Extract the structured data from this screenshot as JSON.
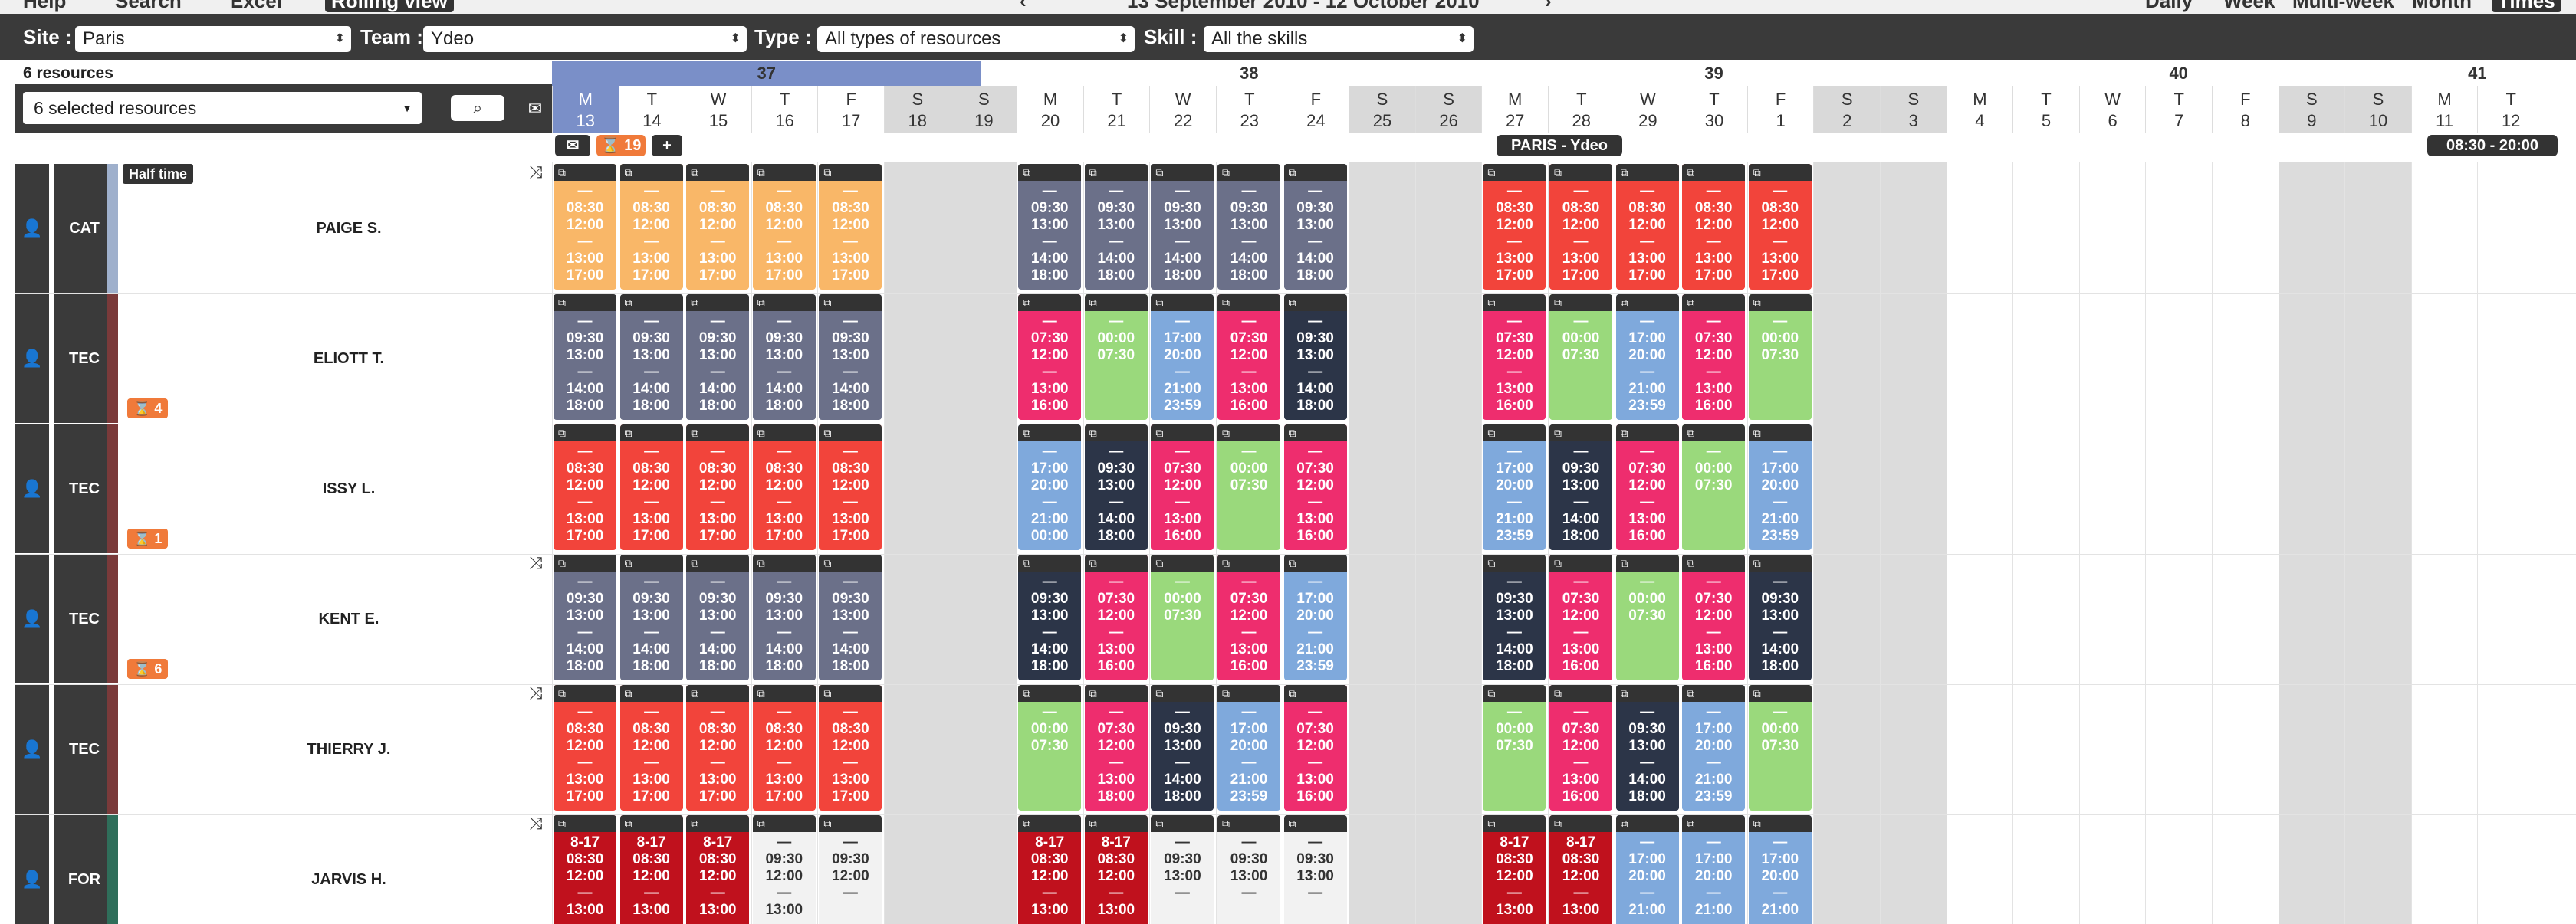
{
  "topbar": {
    "help": "Help",
    "search": "Search",
    "excel": "Excel",
    "rolling": "Rolling view",
    "date_range": "13 September 2010 - 12 October 2010",
    "views": [
      "Daily",
      "Week",
      "Multi-week",
      "Month",
      "Times"
    ]
  },
  "filters": {
    "site_label": "Site :",
    "site_value": "Paris",
    "team_label": "Team :",
    "team_value": "Ydeo",
    "type_label": "Type :",
    "type_value": "All types of resources",
    "skill_label": "Skill :",
    "skill_value": "All the skills"
  },
  "resources_count": "6 resources",
  "resource_select": "6 selected resources",
  "weeks": [
    "37",
    "38",
    "39",
    "40",
    "41"
  ],
  "days": [
    [
      "M",
      "13"
    ],
    [
      "T",
      "14"
    ],
    [
      "W",
      "15"
    ],
    [
      "T",
      "16"
    ],
    [
      "F",
      "17"
    ],
    [
      "S",
      "18"
    ],
    [
      "S",
      "19"
    ],
    [
      "M",
      "20"
    ],
    [
      "T",
      "21"
    ],
    [
      "W",
      "22"
    ],
    [
      "T",
      "23"
    ],
    [
      "F",
      "24"
    ],
    [
      "S",
      "25"
    ],
    [
      "S",
      "26"
    ],
    [
      "M",
      "27"
    ],
    [
      "T",
      "28"
    ],
    [
      "W",
      "29"
    ],
    [
      "T",
      "30"
    ],
    [
      "F",
      "1"
    ],
    [
      "S",
      "2"
    ],
    [
      "S",
      "3"
    ],
    [
      "M",
      "4"
    ],
    [
      "T",
      "5"
    ],
    [
      "W",
      "6"
    ],
    [
      "T",
      "7"
    ],
    [
      "F",
      "8"
    ],
    [
      "S",
      "9"
    ],
    [
      "S",
      "10"
    ],
    [
      "M",
      "11"
    ],
    [
      "T",
      "12"
    ]
  ],
  "toolbar": {
    "count": "19",
    "plus": "+",
    "team_label": "PARIS - Ydeo",
    "hours": "08:30 - 20:00"
  },
  "half_time": "Half time",
  "colors": {
    "orange": "#f9b768",
    "slate": "#6b7089",
    "red": "#f2443b",
    "pink": "#ee2d6e",
    "green": "#9ad97c",
    "blue": "#7fa9dc",
    "navy": "#2c3548",
    "darkred": "#c0111d",
    "white": "#f2f2f2"
  },
  "rows": [
    {
      "cat": "CAT",
      "name": "PAIGE S.",
      "stripe": "#9fb0cc",
      "badge": "",
      "shuffle": true,
      "cells": [
        [
          0,
          "orange",
          "—",
          "08:30",
          "12:00",
          "—",
          "13:00",
          "17:00"
        ],
        [
          1,
          "orange",
          "—",
          "08:30",
          "12:00",
          "—",
          "13:00",
          "17:00"
        ],
        [
          2,
          "orange",
          "—",
          "08:30",
          "12:00",
          "—",
          "13:00",
          "17:00"
        ],
        [
          3,
          "orange",
          "—",
          "08:30",
          "12:00",
          "—",
          "13:00",
          "17:00"
        ],
        [
          4,
          "orange",
          "—",
          "08:30",
          "12:00",
          "—",
          "13:00",
          "17:00"
        ],
        [
          7,
          "slate",
          "—",
          "09:30",
          "13:00",
          "—",
          "14:00",
          "18:00"
        ],
        [
          8,
          "slate",
          "—",
          "09:30",
          "13:00",
          "—",
          "14:00",
          "18:00"
        ],
        [
          9,
          "slate",
          "—",
          "09:30",
          "13:00",
          "—",
          "14:00",
          "18:00"
        ],
        [
          10,
          "slate",
          "—",
          "09:30",
          "13:00",
          "—",
          "14:00",
          "18:00"
        ],
        [
          11,
          "slate",
          "—",
          "09:30",
          "13:00",
          "—",
          "14:00",
          "18:00"
        ],
        [
          14,
          "red",
          "—",
          "08:30",
          "12:00",
          "—",
          "13:00",
          "17:00"
        ],
        [
          15,
          "red",
          "—",
          "08:30",
          "12:00",
          "—",
          "13:00",
          "17:00"
        ],
        [
          16,
          "red",
          "—",
          "08:30",
          "12:00",
          "—",
          "13:00",
          "17:00"
        ],
        [
          17,
          "red",
          "—",
          "08:30",
          "12:00",
          "—",
          "13:00",
          "17:00"
        ],
        [
          18,
          "red",
          "—",
          "08:30",
          "12:00",
          "—",
          "13:00",
          "17:00"
        ]
      ]
    },
    {
      "cat": "TEC",
      "name": "ELIOTT T.",
      "stripe": "#7a3a3a",
      "badge": "4",
      "shuffle": false,
      "cells": [
        [
          0,
          "slate",
          "—",
          "09:30",
          "13:00",
          "—",
          "14:00",
          "18:00"
        ],
        [
          1,
          "slate",
          "—",
          "09:30",
          "13:00",
          "—",
          "14:00",
          "18:00"
        ],
        [
          2,
          "slate",
          "—",
          "09:30",
          "13:00",
          "—",
          "14:00",
          "18:00"
        ],
        [
          3,
          "slate",
          "—",
          "09:30",
          "13:00",
          "—",
          "14:00",
          "18:00"
        ],
        [
          4,
          "slate",
          "—",
          "09:30",
          "13:00",
          "—",
          "14:00",
          "18:00"
        ],
        [
          7,
          "pink",
          "—",
          "07:30",
          "12:00",
          "—",
          "13:00",
          "16:00"
        ],
        [
          8,
          "green",
          "—",
          "00:00",
          "07:30",
          "",
          "",
          ""
        ],
        [
          9,
          "blue",
          "—",
          "17:00",
          "20:00",
          "—",
          "21:00",
          "23:59"
        ],
        [
          10,
          "pink",
          "—",
          "07:30",
          "12:00",
          "—",
          "13:00",
          "16:00"
        ],
        [
          11,
          "navy",
          "—",
          "09:30",
          "13:00",
          "—",
          "14:00",
          "18:00"
        ],
        [
          14,
          "pink",
          "—",
          "07:30",
          "12:00",
          "—",
          "13:00",
          "16:00"
        ],
        [
          15,
          "green",
          "—",
          "00:00",
          "07:30",
          "",
          "",
          ""
        ],
        [
          16,
          "blue",
          "—",
          "17:00",
          "20:00",
          "—",
          "21:00",
          "23:59"
        ],
        [
          17,
          "pink",
          "—",
          "07:30",
          "12:00",
          "—",
          "13:00",
          "16:00"
        ],
        [
          18,
          "green",
          "—",
          "00:00",
          "07:30",
          "",
          "",
          ""
        ]
      ]
    },
    {
      "cat": "TEC",
      "name": "ISSY L.",
      "stripe": "#7a3a3a",
      "badge": "1",
      "shuffle": false,
      "cells": [
        [
          0,
          "red",
          "—",
          "08:30",
          "12:00",
          "—",
          "13:00",
          "17:00"
        ],
        [
          1,
          "red",
          "—",
          "08:30",
          "12:00",
          "—",
          "13:00",
          "17:00"
        ],
        [
          2,
          "red",
          "—",
          "08:30",
          "12:00",
          "—",
          "13:00",
          "17:00"
        ],
        [
          3,
          "red",
          "—",
          "08:30",
          "12:00",
          "—",
          "13:00",
          "17:00"
        ],
        [
          4,
          "red",
          "—",
          "08:30",
          "12:00",
          "—",
          "13:00",
          "17:00"
        ],
        [
          7,
          "blue",
          "—",
          "17:00",
          "20:00",
          "—",
          "21:00",
          "00:00"
        ],
        [
          8,
          "navy",
          "—",
          "09:30",
          "13:00",
          "—",
          "14:00",
          "18:00"
        ],
        [
          9,
          "pink",
          "—",
          "07:30",
          "12:00",
          "—",
          "13:00",
          "16:00"
        ],
        [
          10,
          "green",
          "—",
          "00:00",
          "07:30",
          "",
          "",
          ""
        ],
        [
          11,
          "pink",
          "—",
          "07:30",
          "12:00",
          "—",
          "13:00",
          "16:00"
        ],
        [
          14,
          "blue",
          "—",
          "17:00",
          "20:00",
          "—",
          "21:00",
          "23:59"
        ],
        [
          15,
          "navy",
          "—",
          "09:30",
          "13:00",
          "—",
          "14:00",
          "18:00"
        ],
        [
          16,
          "pink",
          "—",
          "07:30",
          "12:00",
          "—",
          "13:00",
          "16:00"
        ],
        [
          17,
          "green",
          "—",
          "00:00",
          "07:30",
          "",
          "",
          ""
        ],
        [
          18,
          "blue",
          "—",
          "17:00",
          "20:00",
          "—",
          "21:00",
          "23:59"
        ]
      ]
    },
    {
      "cat": "TEC",
      "name": "KENT E.",
      "stripe": "#7a3a3a",
      "badge": "6",
      "shuffle": true,
      "cells": [
        [
          0,
          "slate",
          "—",
          "09:30",
          "13:00",
          "—",
          "14:00",
          "18:00"
        ],
        [
          1,
          "slate",
          "—",
          "09:30",
          "13:00",
          "—",
          "14:00",
          "18:00"
        ],
        [
          2,
          "slate",
          "—",
          "09:30",
          "13:00",
          "—",
          "14:00",
          "18:00"
        ],
        [
          3,
          "slate",
          "—",
          "09:30",
          "13:00",
          "—",
          "14:00",
          "18:00"
        ],
        [
          4,
          "slate",
          "—",
          "09:30",
          "13:00",
          "—",
          "14:00",
          "18:00"
        ],
        [
          7,
          "navy",
          "—",
          "09:30",
          "13:00",
          "—",
          "14:00",
          "18:00"
        ],
        [
          8,
          "pink",
          "—",
          "07:30",
          "12:00",
          "—",
          "13:00",
          "16:00"
        ],
        [
          9,
          "green",
          "—",
          "00:00",
          "07:30",
          "",
          "",
          ""
        ],
        [
          10,
          "pink",
          "—",
          "07:30",
          "12:00",
          "—",
          "13:00",
          "16:00"
        ],
        [
          11,
          "blue",
          "—",
          "17:00",
          "20:00",
          "—",
          "21:00",
          "23:59"
        ],
        [
          14,
          "navy",
          "—",
          "09:30",
          "13:00",
          "—",
          "14:00",
          "18:00"
        ],
        [
          15,
          "pink",
          "—",
          "07:30",
          "12:00",
          "—",
          "13:00",
          "16:00"
        ],
        [
          16,
          "green",
          "—",
          "00:00",
          "07:30",
          "",
          "",
          ""
        ],
        [
          17,
          "pink",
          "—",
          "07:30",
          "12:00",
          "—",
          "13:00",
          "16:00"
        ],
        [
          18,
          "navy",
          "—",
          "09:30",
          "13:00",
          "—",
          "14:00",
          "18:00"
        ]
      ]
    },
    {
      "cat": "TEC",
      "name": "THIERRY J.",
      "stripe": "#7a3a3a",
      "badge": "",
      "shuffle": true,
      "cells": [
        [
          0,
          "red",
          "—",
          "08:30",
          "12:00",
          "—",
          "13:00",
          "17:00"
        ],
        [
          1,
          "red",
          "—",
          "08:30",
          "12:00",
          "—",
          "13:00",
          "17:00"
        ],
        [
          2,
          "red",
          "—",
          "08:30",
          "12:00",
          "—",
          "13:00",
          "17:00"
        ],
        [
          3,
          "red",
          "—",
          "08:30",
          "12:00",
          "—",
          "13:00",
          "17:00"
        ],
        [
          4,
          "red",
          "—",
          "08:30",
          "12:00",
          "—",
          "13:00",
          "17:00"
        ],
        [
          7,
          "green",
          "—",
          "00:00",
          "07:30",
          "",
          "",
          ""
        ],
        [
          8,
          "pink",
          "—",
          "07:30",
          "12:00",
          "—",
          "13:00",
          "18:00"
        ],
        [
          9,
          "navy",
          "—",
          "09:30",
          "13:00",
          "—",
          "14:00",
          "18:00"
        ],
        [
          10,
          "blue",
          "—",
          "17:00",
          "20:00",
          "—",
          "21:00",
          "23:59"
        ],
        [
          11,
          "pink",
          "—",
          "07:30",
          "12:00",
          "—",
          "13:00",
          "16:00"
        ],
        [
          14,
          "green",
          "—",
          "00:00",
          "07:30",
          "",
          "",
          ""
        ],
        [
          15,
          "pink",
          "—",
          "07:30",
          "12:00",
          "—",
          "13:00",
          "16:00"
        ],
        [
          16,
          "navy",
          "—",
          "09:30",
          "13:00",
          "—",
          "14:00",
          "18:00"
        ],
        [
          17,
          "blue",
          "—",
          "17:00",
          "20:00",
          "—",
          "21:00",
          "23:59"
        ],
        [
          18,
          "green",
          "—",
          "00:00",
          "07:30",
          "",
          "",
          ""
        ]
      ]
    },
    {
      "cat": "FOR",
      "name": "JARVIS H.",
      "stripe": "#2f6e5a",
      "badge": "",
      "shuffle": true,
      "cells": [
        [
          0,
          "darkred",
          "8-17",
          "08:30",
          "12:00",
          "—",
          "13:00",
          ""
        ],
        [
          1,
          "darkred",
          "8-17",
          "08:30",
          "12:00",
          "—",
          "13:00",
          ""
        ],
        [
          2,
          "darkred",
          "8-17",
          "08:30",
          "12:00",
          "—",
          "13:00",
          ""
        ],
        [
          3,
          "white",
          "—",
          "09:30",
          "12:00",
          "—",
          "13:00",
          ""
        ],
        [
          4,
          "white",
          "—",
          "09:30",
          "12:00",
          "—",
          "",
          ""
        ],
        [
          7,
          "darkred",
          "8-17",
          "08:30",
          "12:00",
          "—",
          "13:00",
          ""
        ],
        [
          8,
          "darkred",
          "8-17",
          "08:30",
          "12:00",
          "—",
          "13:00",
          ""
        ],
        [
          9,
          "white",
          "—",
          "09:30",
          "13:00",
          "—",
          "",
          ""
        ],
        [
          10,
          "white",
          "—",
          "09:30",
          "13:00",
          "—",
          "",
          ""
        ],
        [
          11,
          "white",
          "—",
          "09:30",
          "13:00",
          "—",
          "",
          ""
        ],
        [
          14,
          "darkred",
          "8-17",
          "08:30",
          "12:00",
          "—",
          "13:00",
          ""
        ],
        [
          15,
          "darkred",
          "8-17",
          "08:30",
          "12:00",
          "—",
          "13:00",
          ""
        ],
        [
          16,
          "blue",
          "—",
          "17:00",
          "20:00",
          "—",
          "21:00",
          ""
        ],
        [
          17,
          "blue",
          "—",
          "17:00",
          "20:00",
          "—",
          "21:00",
          ""
        ],
        [
          18,
          "blue",
          "—",
          "17:00",
          "20:00",
          "—",
          "21:00",
          ""
        ]
      ]
    }
  ]
}
